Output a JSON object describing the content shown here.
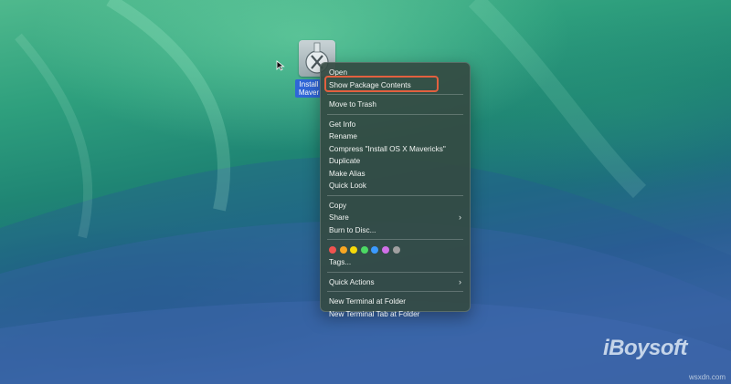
{
  "desktop": {
    "icon_label": "Install OS X Mavericks",
    "icon_label_visible_line1": "Install",
    "icon_label_visible_line2": "Maver"
  },
  "context_menu": {
    "group1": [
      {
        "label": "Open"
      },
      {
        "label": "Show Package Contents",
        "highlighted": true
      }
    ],
    "group2": [
      {
        "label": "Move to Trash"
      }
    ],
    "group3": [
      {
        "label": "Get Info"
      },
      {
        "label": "Rename"
      },
      {
        "label": "Compress \"Install OS X Mavericks\""
      },
      {
        "label": "Duplicate"
      },
      {
        "label": "Make Alias"
      },
      {
        "label": "Quick Look"
      }
    ],
    "group4": [
      {
        "label": "Copy"
      },
      {
        "label": "Share",
        "submenu": true
      },
      {
        "label": "Burn to Disc..."
      }
    ],
    "tag_colors": [
      "#ef5350",
      "#f6a623",
      "#f5d90a",
      "#4cd964",
      "#3b9bff",
      "#d070e8",
      "#a0a0a0"
    ],
    "group5": [
      {
        "label": "Tags..."
      }
    ],
    "group6": [
      {
        "label": "Quick Actions",
        "submenu": true
      }
    ],
    "group7": [
      {
        "label": "New Terminal at Folder"
      },
      {
        "label": "New Terminal Tab at Folder"
      }
    ],
    "submenu_glyph": "›"
  },
  "watermark": {
    "brand": "iBoysoft",
    "site": "wsxdn.com"
  },
  "colors": {
    "highlight_border": "#e2603f",
    "selection_blue": "#2f66d8"
  }
}
